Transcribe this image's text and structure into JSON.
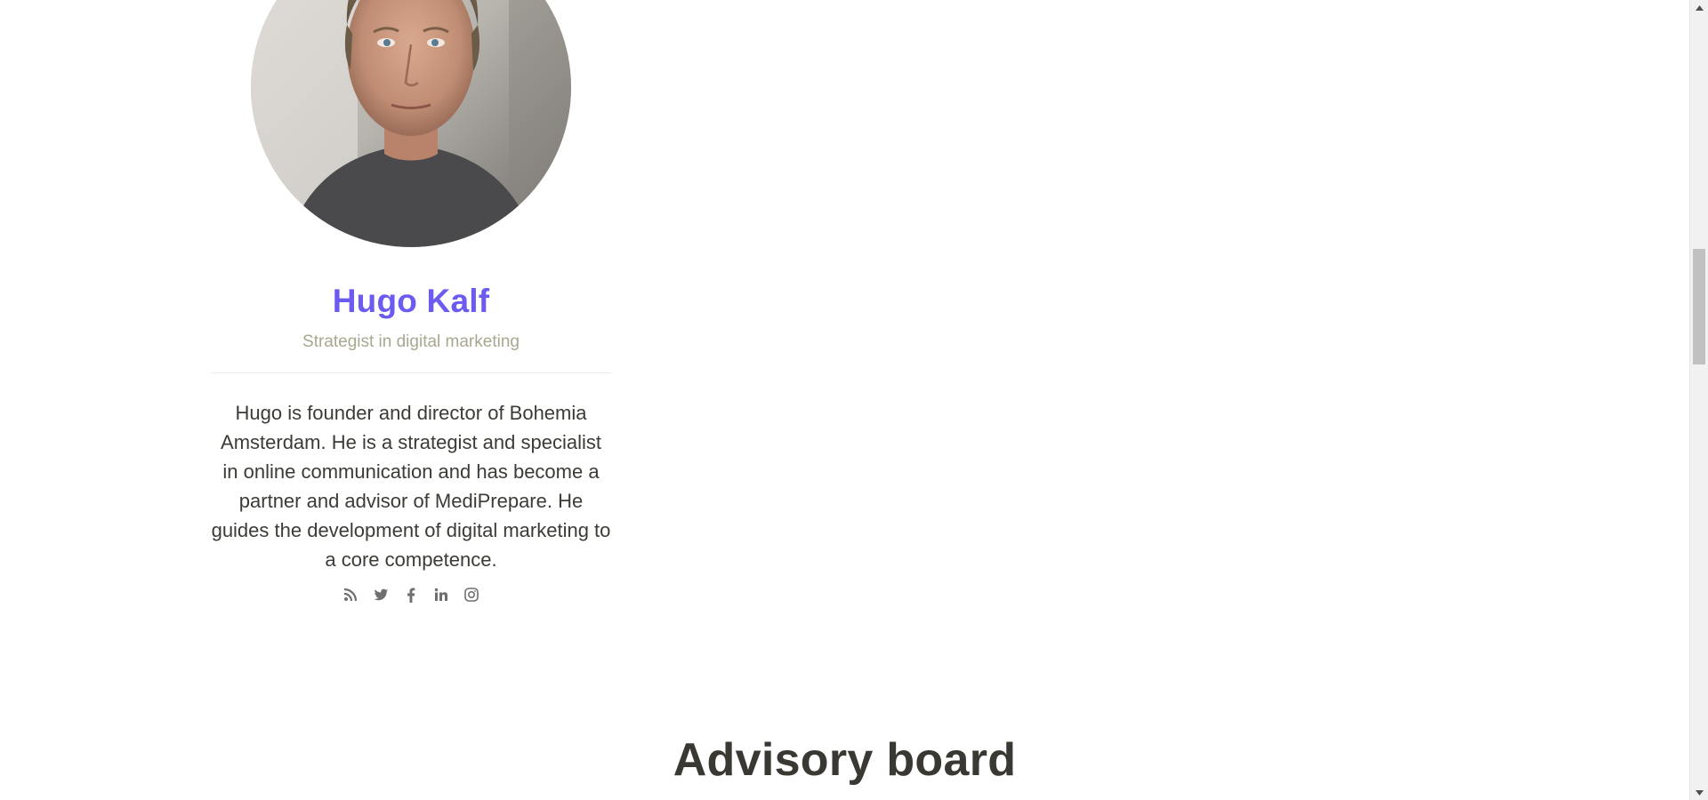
{
  "member": {
    "name": "Hugo Kalf",
    "role": "Strategist in digital marketing",
    "bio": "Hugo is founder and director of Bohemia Amsterdam. He is a strategist and specialist in online communication and has become a partner and advisor of MediPrepare. He guides the development of digital marketing to a core competence.",
    "photo_alt": "Hugo Kalf portrait",
    "socials": [
      {
        "icon": "rss-icon"
      },
      {
        "icon": "twitter-icon"
      },
      {
        "icon": "facebook-icon"
      },
      {
        "icon": "linkedin-icon"
      },
      {
        "icon": "instagram-icon"
      }
    ]
  },
  "section": {
    "title": "Advisory board"
  },
  "colors": {
    "name_accent": "#6b5bf0",
    "role_text": "#a8a890",
    "body_text": "#3d3b36",
    "heading_text": "#3a3833",
    "icon_color": "#6f6f6f"
  }
}
